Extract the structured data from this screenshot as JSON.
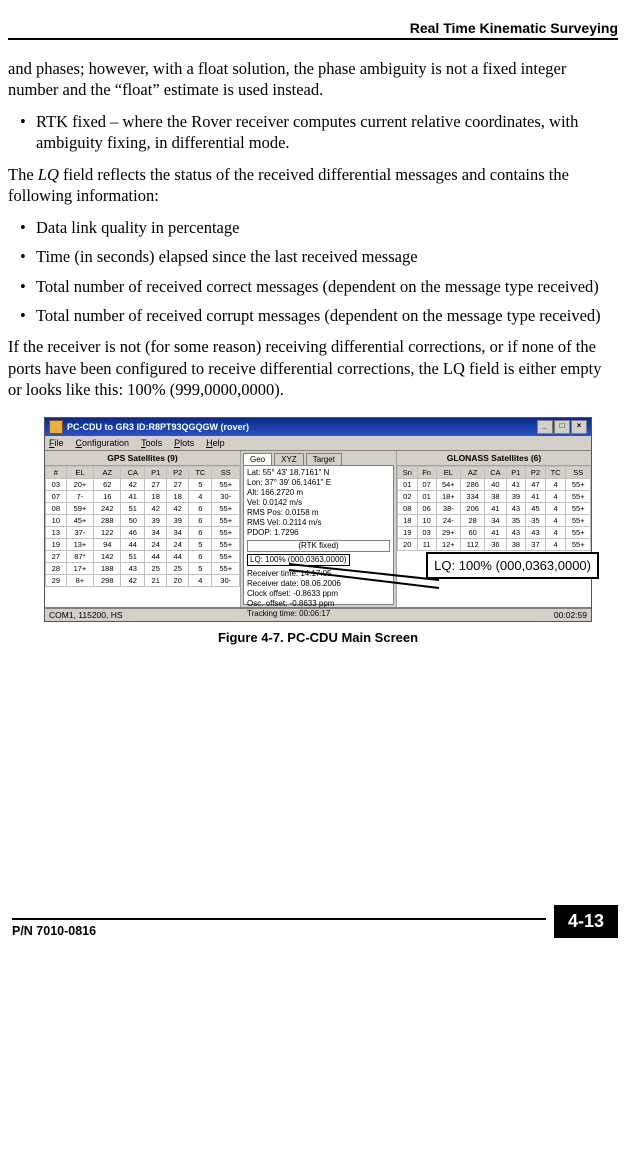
{
  "header": {
    "title": "Real Time Kinematic Surveying"
  },
  "para1": "and phases; however, with a float solution, the phase ambiguity is not a fixed integer number and the “float” estimate is used instead.",
  "bullet_a": "RTK fixed – where the Rover receiver computes current relative coordinates, with ambiguity fixing, in differential mode.",
  "para2a": "The ",
  "para2b": "LQ",
  "para2c": " field reflects the status of the received differential messages and contains the following information:",
  "list": [
    "Data link quality in percentage",
    "Time (in seconds) elapsed since the last received message",
    "Total number of received correct messages (dependent on the message type received)",
    "Total number of received corrupt messages (dependent on the message type received)"
  ],
  "para3": "If the receiver is not (for some reason) receiving differential corrections, or if none of the ports have been configured to receive differential corrections, the LQ field is either empty or looks like this: 100% (999,0000,0000).",
  "window": {
    "title": "PC-CDU to GR3 ID:R8PT93QGQGW  (rover)",
    "btns": {
      "min": "_",
      "max": "□",
      "close": "×"
    },
    "menu": [
      "File",
      "Configuration",
      "Tools",
      "Plots",
      "Help"
    ],
    "gps_title": "GPS Satellites (9)",
    "glo_title": "GLONASS Satellites (6)",
    "headers_gps": [
      "#",
      "EL",
      "AZ",
      "CA",
      "P1",
      "P2",
      "TC",
      "SS"
    ],
    "gps_rows": [
      [
        "03",
        "20+",
        "62",
        "42",
        "27",
        "27",
        "5",
        "55+"
      ],
      [
        "07",
        "7-",
        "16",
        "41",
        "18",
        "18",
        "4",
        "30-"
      ],
      [
        "08",
        "59+",
        "242",
        "51",
        "42",
        "42",
        "6",
        "55+"
      ],
      [
        "10",
        "45+",
        "288",
        "50",
        "39",
        "39",
        "6",
        "55+"
      ],
      [
        "13",
        "37-",
        "122",
        "46",
        "34",
        "34",
        "6",
        "55+"
      ],
      [
        "19",
        "13+",
        "94",
        "44",
        "24",
        "24",
        "5",
        "55+"
      ],
      [
        "27",
        "87*",
        "142",
        "51",
        "44",
        "44",
        "6",
        "55+"
      ],
      [
        "28",
        "17+",
        "188",
        "43",
        "25",
        "25",
        "5",
        "55+"
      ],
      [
        "29",
        "8+",
        "298",
        "42",
        "21",
        "20",
        "4",
        "30-"
      ]
    ],
    "headers_glo": [
      "Sn",
      "Fn",
      "EL",
      "AZ",
      "CA",
      "P1",
      "P2",
      "TC",
      "SS"
    ],
    "glo_rows": [
      [
        "01",
        "07",
        "54+",
        "286",
        "40",
        "41",
        "47",
        "4",
        "55+"
      ],
      [
        "02",
        "01",
        "18+",
        "334",
        "38",
        "39",
        "41",
        "4",
        "55+"
      ],
      [
        "08",
        "06",
        "38-",
        "206",
        "41",
        "43",
        "45",
        "4",
        "55+"
      ],
      [
        "18",
        "10",
        "24-",
        "28",
        "34",
        "35",
        "35",
        "4",
        "55+"
      ],
      [
        "19",
        "03",
        "29+",
        "60",
        "41",
        "43",
        "43",
        "4",
        "55+"
      ],
      [
        "20",
        "11",
        "12+",
        "112",
        "36",
        "38",
        "37",
        "4",
        "55+"
      ]
    ],
    "tabs": [
      "Geo",
      "XYZ",
      "Target"
    ],
    "mid": {
      "l1": "Lat: 55° 43' 18.7161\" N",
      "l2": "Lon: 37° 39' 06.1461\" E",
      "l3": "Alt: 166.2720 m",
      "l4": "Vel: 0.0142 m/s",
      "l5": "RMS Pos: 0.0158 m",
      "l6": "RMS Vel: 0.2114 m/s",
      "l7": "PDOP: 1.7296",
      "rtk": "(RTK fixed)",
      "lq": "LQ: 100% (000,0363,0000)",
      "b1": "Receiver time: 14:17:05",
      "b2": "Receiver date: 08.06.2006",
      "b3": "Clock offset:  -0.8633 ppm",
      "b4": "Osc. offset:   -0.8633 ppm",
      "b5": "Tracking time: 00:06:17"
    },
    "status_left": "COM1, 115200, HS",
    "status_right": "00:02:59"
  },
  "callout": "LQ: 100% (000,0363,0000)",
  "caption": "Figure 4-7. PC-CDU Main Screen",
  "footer": {
    "pn": "P/N 7010-0816",
    "page": "4-13"
  }
}
